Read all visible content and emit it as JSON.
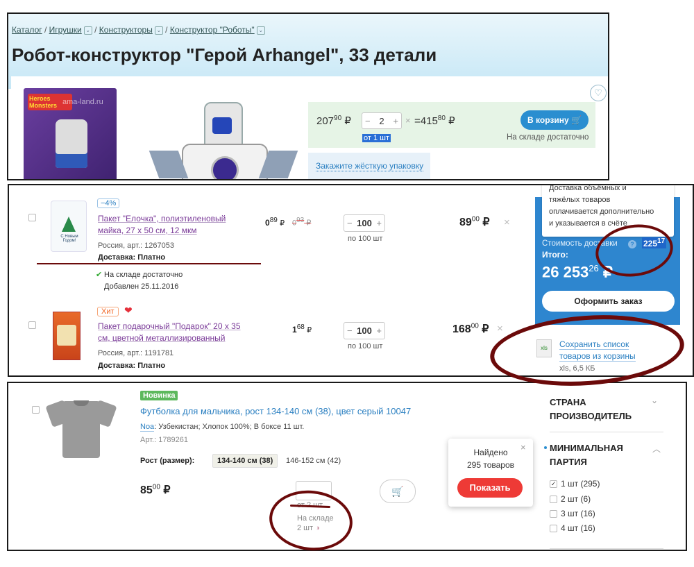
{
  "breadcrumbs": [
    "Каталог",
    "Игрушки",
    "Конструкторы",
    "Конструктор \"Роботы\""
  ],
  "product": {
    "title": "Робот-конструктор \"Герой Arhangel\", 33 детали",
    "watermark": "ama-land.ru",
    "box_text": "Heroes Monsters",
    "price_int": "207",
    "price_dec": "90",
    "qty": "2",
    "total_int": "415",
    "total_dec": "80",
    "min_qty": "от 1 шт",
    "cart_label": "В корзину",
    "stock": "На складе достаточно",
    "packaging": "Закажите жёсткую упаковку"
  },
  "cart_items": [
    {
      "badge": "−4%",
      "name": "Пакет \"Елочка\", полиэтиленовый майка, 27 х 50 см, 12 мкм",
      "name_line1": "Пакет \"Елочка\", полиэтиленовый",
      "name_line2": "майка, 27 х 50 см, 12 мкм",
      "origin": "Россия, арт.: 1267053",
      "delivery": "Доставка: Платно",
      "price_int": "0",
      "price_dec": "89",
      "old_price_int": "0",
      "old_price_dec": "93",
      "qty": "100",
      "qty_note": "по 100 шт",
      "total_int": "89",
      "total_dec": "00",
      "stock": "На складе достаточно",
      "added": "Добавлен 25.11.2016",
      "bag_text": "С Новым Годом!"
    },
    {
      "badge": "Хит",
      "name_line1": "Пакет подарочный \"Подарок\" 20 х 35",
      "name_line2": "см, цветной металлизированный",
      "origin": "Россия, арт.: 1191781",
      "delivery": "Доставка: Платно",
      "price_int": "1",
      "price_dec": "68",
      "qty": "100",
      "qty_note": "по 100 шт",
      "total_int": "168",
      "total_dec": "00"
    }
  ],
  "summary": {
    "note_lines": [
      "Доставка объёмных и",
      "тяжёлых товаров",
      "оплачивается дополнительно",
      "и указывается в счёте"
    ],
    "delivery_label": "Стоимость доставки",
    "delivery_int": "225",
    "delivery_dec": "17",
    "total_label": "Итого:",
    "total_int": "26 253",
    "total_dec": "26",
    "order_button": "Оформить заказ",
    "save_list_line1": "Сохранить список",
    "save_list_line2": "товаров из корзины",
    "file_info": "xls, 6,5 КБ",
    "file_icon": "xls"
  },
  "listing": {
    "badge": "Новинка",
    "title": "Футболка для мальчика, рост 134-140 см (38), цвет серый 10047",
    "brand": "Noa",
    "details": ": Узбекистан; Хлопок 100%; В боксе 11 шт.",
    "article": "Арт.: 1789261",
    "size_label": "Рост (размер):",
    "sizes": [
      "134-140 см (38)",
      "146-152 см (42)"
    ],
    "price_int": "85",
    "price_dec": "00",
    "min_qty": "от 2 шт",
    "stock_label": "На складе",
    "stock_count": "2 шт"
  },
  "popup": {
    "line1": "Найдено",
    "line2": "295 товаров",
    "button": "Показать"
  },
  "filters": {
    "country_title_1": "СТРАНА",
    "country_title_2": "ПРОИЗВОДИТЕЛЬ",
    "min_title_1": "МИНИМАЛЬНАЯ",
    "min_title_2": "ПАРТИЯ",
    "options": [
      {
        "label": "1 шт (295)",
        "checked": true
      },
      {
        "label": "2 шт (6)",
        "checked": false
      },
      {
        "label": "3 шт (16)",
        "checked": false
      },
      {
        "label": "4 шт (16)",
        "checked": false
      }
    ]
  },
  "colors": {
    "accent_blue": "#2a8ed0",
    "cart_button": "#2a8ed0",
    "summary_bg": "#2e86cf",
    "highlight_green": "#e6f4e6",
    "show_button": "#ee3a36",
    "annotation": "#6b0a0a",
    "new_badge": "#5cb85c",
    "hit_badge": "#f26522"
  },
  "currency": "₽"
}
